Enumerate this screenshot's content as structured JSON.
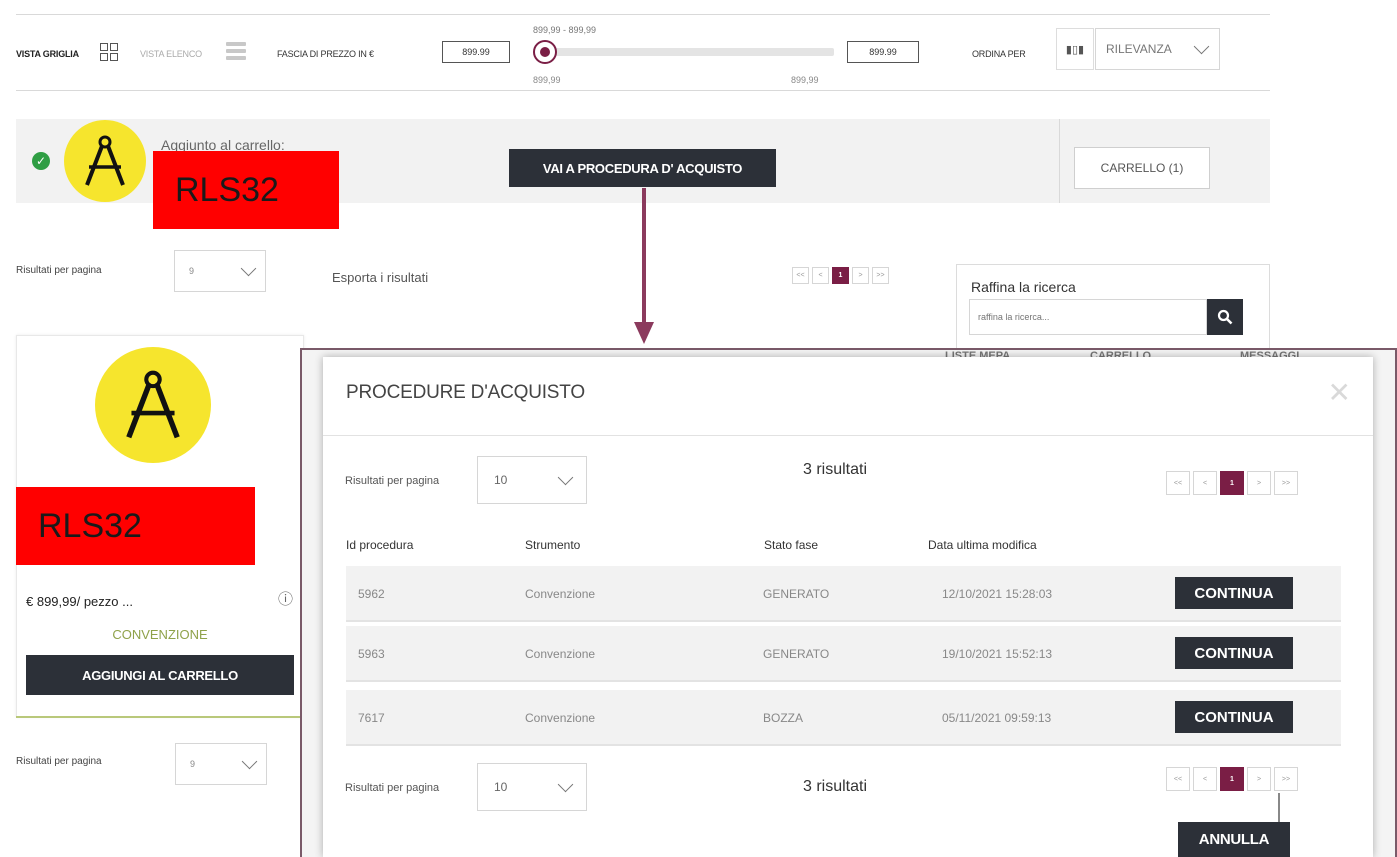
{
  "toolbar": {
    "grid_view_label": "VISTA GRIGLIA",
    "list_view_label": "VISTA ELENCO",
    "price_range_label": "FASCIA DI PREZZO IN €",
    "price_min_input": "899.99",
    "price_max_input": "899.99",
    "slider_range_text": "899,99 - 899,99",
    "slider_min_text": "899,99",
    "slider_max_text": "899,99",
    "sort_label": "ORDINA PER",
    "sort_icon_glyph": "▮▯▮",
    "sort_value": "RILEVANZA"
  },
  "banner": {
    "added_text": "Aggiunto al carrello:",
    "product_code": "RLS32",
    "checkout_button": "VAI A PROCEDURA D' ACQUISTO",
    "cart_button": "CARRELLO (1)"
  },
  "results_bar": {
    "per_page_label": "Risultati per pagina",
    "per_page_value": "9",
    "export_label": "Esporta i risultati",
    "pager": [
      "<<",
      "<",
      "1",
      ">",
      ">>"
    ]
  },
  "search": {
    "title": "Raffina la ricerca",
    "placeholder": "raffina la ricerca..."
  },
  "background_header": {
    "item_1": "LISTE MEPA",
    "item_2": "CARRELLO",
    "item_3": "MESSAGGI"
  },
  "product_card": {
    "code": "RLS32",
    "price": "€ 899,99/ pezzo ...",
    "info_icon": "ⓘ",
    "type": "CONVENZIONE",
    "add_button": "AGGIUNGI AL CARRELLO"
  },
  "bottom_bar": {
    "per_page_label": "Risultati per pagina",
    "per_page_value": "9"
  },
  "modal": {
    "title": "PROCEDURE D'ACQUISTO",
    "close_glyph": "✕",
    "per_page_label": "Risultati per pagina",
    "per_page_value": "10",
    "results_count": "3 risultati",
    "pager": [
      "<<",
      "<",
      "1",
      ">",
      ">>"
    ],
    "columns": [
      "Id procedura",
      "Strumento",
      "Stato fase",
      "Data ultima modifica"
    ],
    "rows": [
      {
        "id": "5962",
        "strumento": "Convenzione",
        "stato": "GENERATO",
        "data": "12/10/2021 15:28:03",
        "action": "CONTINUA"
      },
      {
        "id": "5963",
        "strumento": "Convenzione",
        "stato": "GENERATO",
        "data": "19/10/2021 15:52:13",
        "action": "CONTINUA"
      },
      {
        "id": "7617",
        "strumento": "Convenzione",
        "stato": "BOZZA",
        "data": "05/11/2021 09:59:13",
        "action": "CONTINUA"
      }
    ],
    "footer_per_page_label": "Risultati per pagina",
    "footer_per_page_value": "10",
    "footer_results_count": "3 risultati",
    "footer_pager": [
      "<<",
      "<",
      "1",
      ">",
      ">>"
    ],
    "cancel_button": "ANNULLA"
  },
  "colors": {
    "accent": "#7a1e45",
    "dark_button": "#2c3038",
    "logo_yellow": "#f6e52d",
    "redaction": "#ff0000",
    "check_green": "#2f9e44"
  },
  "icons": {
    "logo": "compass-icon",
    "check": "check-circle-icon",
    "search": "search-icon",
    "close": "close-icon"
  }
}
